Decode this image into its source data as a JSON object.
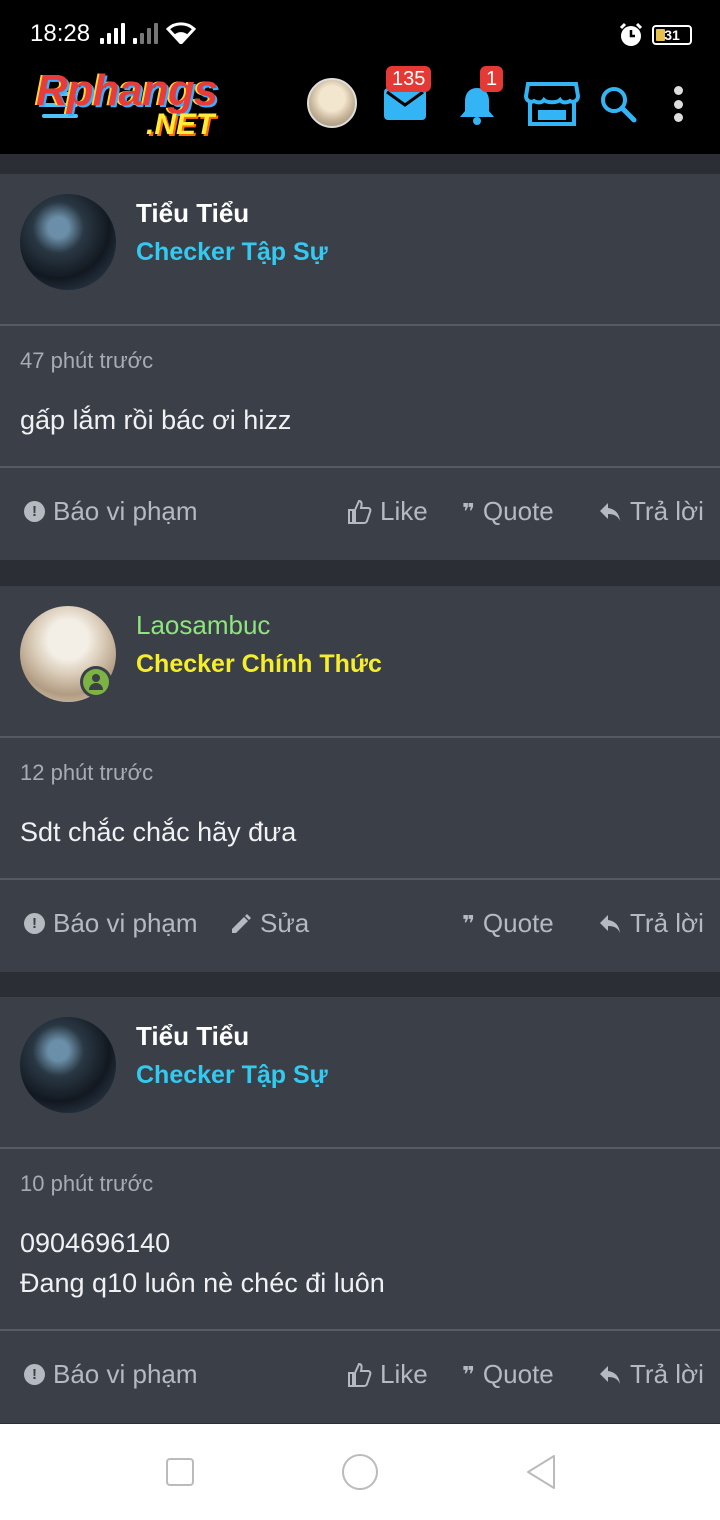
{
  "status_bar": {
    "time": "18:28",
    "battery": "31"
  },
  "header": {
    "logo_line1": "Rphangs",
    "logo_line2": ".NET",
    "mail_badge": "135",
    "bell_badge": "1",
    "icons": [
      "menu-icon",
      "avatar",
      "mail-icon",
      "bell-icon",
      "store-icon",
      "search-icon",
      "more-icon"
    ],
    "accent_color": "#33b5f5"
  },
  "posts": [
    {
      "username": "Tiểu Tiểu",
      "rank": "Checker Tập Sự",
      "time": "47 phút trước",
      "content": "gấp lắm rồi bác ơi hizz",
      "actions": {
        "report": "Báo vi phạm",
        "like": "Like",
        "quote": "Quote",
        "reply": "Trả lời"
      }
    },
    {
      "username": "Laosambuc",
      "rank": "Checker Chính Thức",
      "time": "12 phút trước",
      "content": "Sdt chắc chắc hãy đưa",
      "actions": {
        "report": "Báo vi phạm",
        "edit": "Sửa",
        "quote": "Quote",
        "reply": "Trả lời"
      }
    },
    {
      "username": "Tiểu Tiểu",
      "rank": "Checker Tập Sự",
      "time": "10 phút trước",
      "content": "0904696140\nĐang q10 luôn nè chéc đi luôn",
      "actions": {
        "report": "Báo vi phạm",
        "like": "Like",
        "quote": "Quote",
        "reply": "Trả lời"
      }
    }
  ],
  "colors": {
    "rank_tap_su": "#33c9f0",
    "rank_chinh_thuc": "#f5ee2a",
    "online_username": "#8ee57e"
  }
}
